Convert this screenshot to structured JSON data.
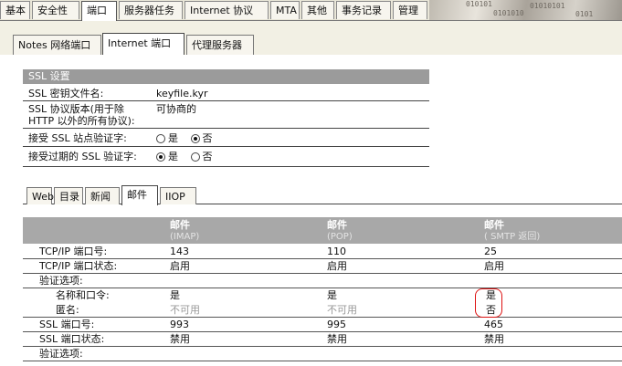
{
  "top_tabs": [
    "基本",
    "安全性",
    "端口",
    "服务器任务",
    "Internet 协议",
    "MTA",
    "其他",
    "事务记录",
    "管理"
  ],
  "logo_text": [
    "010101",
    "01010101",
    "0101010",
    "0101"
  ],
  "sub_tabs": [
    "Notes 网络端口",
    "Internet 端口",
    "代理服务器"
  ],
  "ssl": {
    "header": "SSL 设置",
    "key_file_label": "SSL 密钥文件名:",
    "key_file_value": "keyfile.kyr",
    "protocol_label_1": "SSL 协议版本(用于除",
    "protocol_label_2": "HTTP 以外的所有协议):",
    "protocol_value": "可协商的",
    "accept_site_label": "接受 SSL 站点验证字:",
    "accept_expired_label": "接受过期的 SSL 验证字:",
    "yes": "是",
    "no": "否"
  },
  "inner_tabs": [
    "Web",
    "目录",
    "新闻",
    "邮件",
    "IIOP"
  ],
  "table": {
    "columns": [
      {
        "title": "邮件",
        "sub": "(IMAP)"
      },
      {
        "title": "邮件",
        "sub": "(POP)"
      },
      {
        "title": "邮件",
        "sub": "( SMTP 返回)"
      }
    ],
    "rows": [
      {
        "label": "TCP/IP 端口号:",
        "values": [
          "143",
          "110",
          "25"
        ]
      },
      {
        "label": "TCP/IP 端口状态:",
        "values": [
          "启用",
          "启用",
          "启用"
        ]
      },
      {
        "label": "验证选项:",
        "values": [
          "",
          "",
          ""
        ]
      },
      {
        "label": "名称和口令:",
        "values": [
          "是",
          "是",
          "是"
        ]
      },
      {
        "label": "匿名:",
        "values": [
          "不可用",
          "不可用",
          "否"
        ]
      },
      {
        "label": "SSL 端口号:",
        "values": [
          "993",
          "995",
          "465"
        ]
      },
      {
        "label": "SSL 端口状态:",
        "values": [
          "禁用",
          "禁用",
          "禁用"
        ]
      },
      {
        "label": "验证选项:",
        "values": [
          "",
          "",
          ""
        ]
      }
    ]
  }
}
